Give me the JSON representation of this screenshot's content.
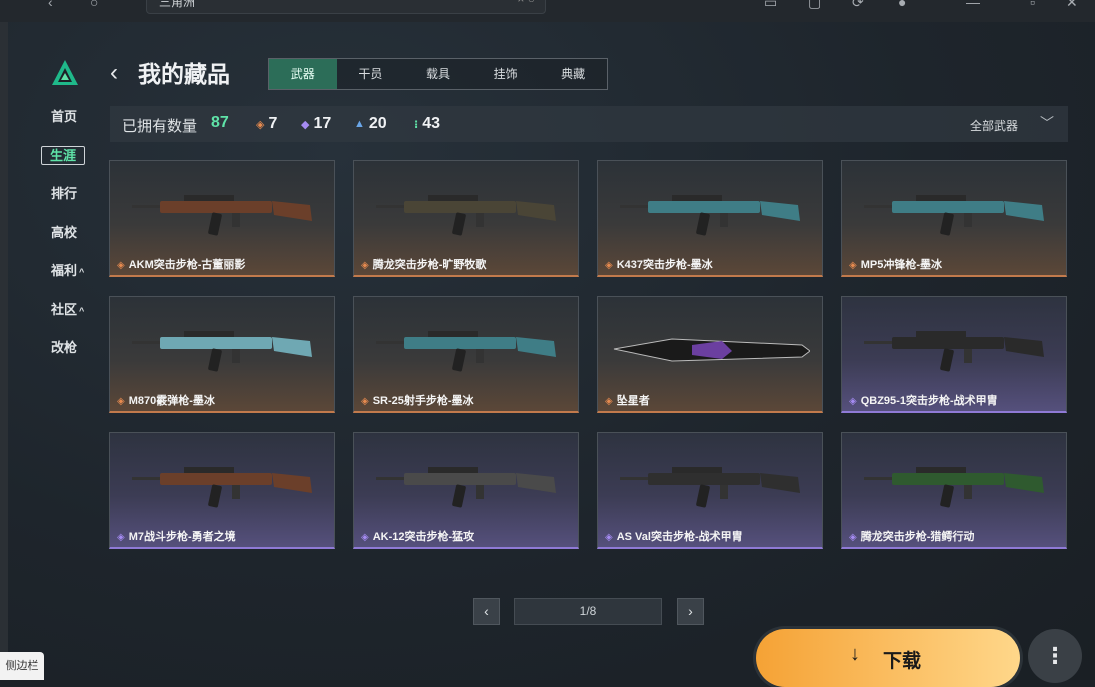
{
  "topbar": {
    "search_value": "三角洲",
    "search_clear": "× ○"
  },
  "nav": [
    {
      "label": "首页",
      "caret": ""
    },
    {
      "label": "生涯",
      "caret": ""
    },
    {
      "label": "排行",
      "caret": ""
    },
    {
      "label": "高校",
      "caret": ""
    },
    {
      "label": "福利",
      "caret": "^"
    },
    {
      "label": "社区",
      "caret": "^"
    },
    {
      "label": "改枪",
      "caret": ""
    }
  ],
  "header": {
    "back": "‹",
    "title": "我的藏品"
  },
  "tabs": [
    "武器",
    "干员",
    "载具",
    "挂饰",
    "典藏"
  ],
  "counts": {
    "label": "已拥有数量",
    "total": "87",
    "orange": "7",
    "purple": "17",
    "blue": "20",
    "other": "43",
    "filter": "全部武器",
    "filter_icon": "chevron-down-icon"
  },
  "items": [
    {
      "label": "AKM突击步枪-古董丽影",
      "rarity": "orange"
    },
    {
      "label": "腾龙突击步枪-旷野牧歌",
      "rarity": "orange"
    },
    {
      "label": "K437突击步枪-墨冰",
      "rarity": "orange"
    },
    {
      "label": "MP5冲锋枪-墨冰",
      "rarity": "orange"
    },
    {
      "label": "M870霰弹枪-墨冰",
      "rarity": "orange"
    },
    {
      "label": "SR-25射手步枪-墨冰",
      "rarity": "orange"
    },
    {
      "label": "坠星者",
      "rarity": "orange"
    },
    {
      "label": "QBZ95-1突击步枪-战术甲胄",
      "rarity": "purple"
    },
    {
      "label": "M7战斗步枪-勇者之境",
      "rarity": "purple"
    },
    {
      "label": "AK-12突击步枪-猛攻",
      "rarity": "purple"
    },
    {
      "label": "AS Val突击步枪-战术甲胄",
      "rarity": "purple"
    },
    {
      "label": "腾龙突击步枪-猎鳄行动",
      "rarity": "purple"
    }
  ],
  "pager": {
    "prev": "‹",
    "page": "1/8",
    "next": "›"
  },
  "download": {
    "arrow": "↓",
    "label": "下载"
  },
  "more": "⋮",
  "sidebar_hint": "侧边栏",
  "colors": {
    "accent": "#5fe3a8",
    "orange": "#e68a4f",
    "purple": "#a58bf2",
    "download": "#f5a235"
  }
}
